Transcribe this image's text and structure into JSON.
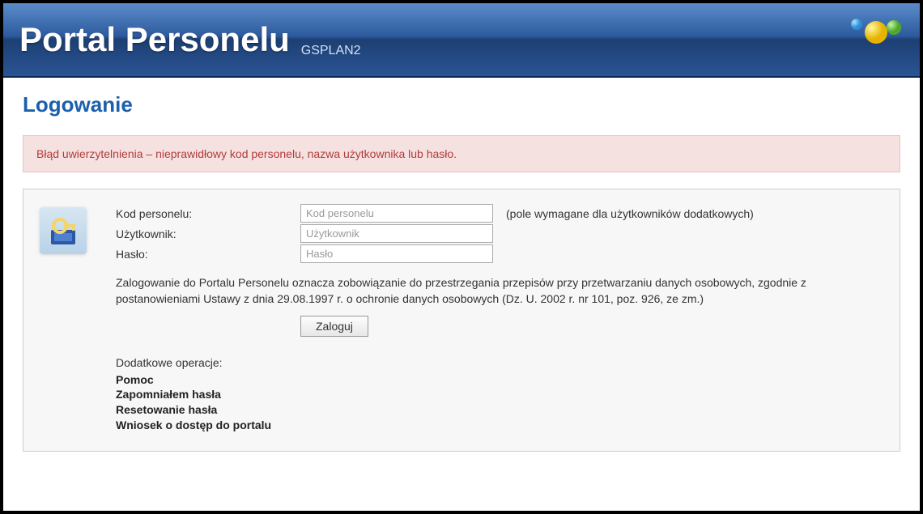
{
  "header": {
    "title": "Portal Personelu",
    "subtitle": "GSPLAN2"
  },
  "page": {
    "title": "Logowanie"
  },
  "alert": {
    "message": "Błąd uwierzytelnienia – nieprawidłowy kod personelu, nazwa użytkownika lub hasło."
  },
  "form": {
    "code_label": "Kod personelu:",
    "code_placeholder": "Kod personelu",
    "code_hint": "(pole wymagane dla użytkowników dodatkowych)",
    "user_label": "Użytkownik:",
    "user_placeholder": "Użytkownik",
    "pass_label": "Hasło:",
    "pass_placeholder": "Hasło",
    "disclaimer": "Zalogowanie do Portalu Personelu oznacza zobowiązanie do przestrzegania przepisów przy przetwarzaniu danych osobowych, zgodnie z postanowieniami Ustawy z dnia 29.08.1997 r. o ochronie danych osobowych (Dz. U. 2002 r. nr 101, poz. 926, ze zm.)",
    "submit_label": "Zaloguj"
  },
  "ops": {
    "title": "Dodatkowe operacje:",
    "links": [
      "Pomoc",
      "Zapomniałem hasła",
      "Resetowanie hasła",
      "Wniosek o dostęp do portalu"
    ]
  }
}
